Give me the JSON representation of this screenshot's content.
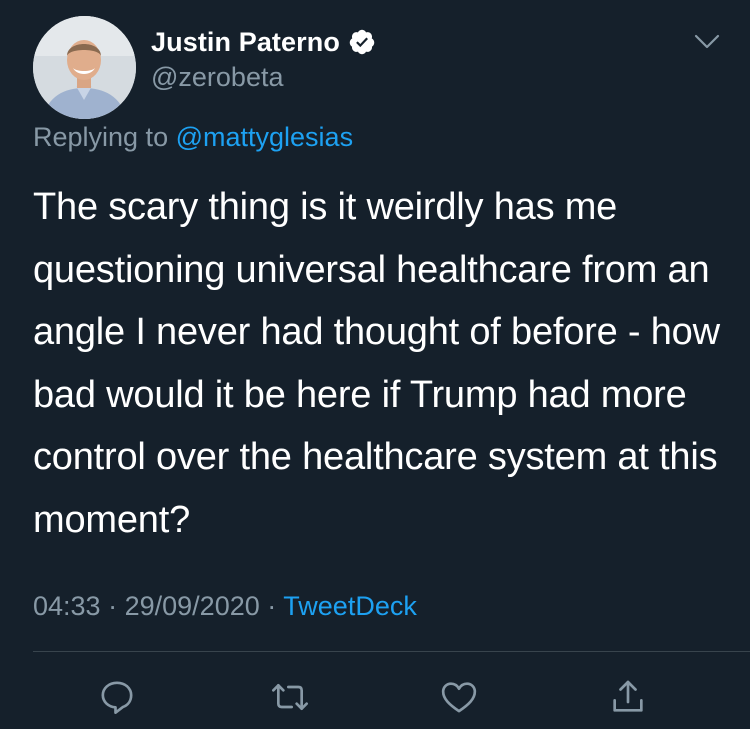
{
  "author": {
    "display_name": "Justin Paterno",
    "handle": "@zerobeta",
    "verified_icon": "verified-badge-icon"
  },
  "reply": {
    "prefix": "Replying to",
    "mention": "@mattyglesias"
  },
  "tweet": {
    "text": "The scary thing is it weirdly has me questioning universal healthcare from an angle I never had thought of before - how bad would it be here if Trump had more control over the healthcare system at this moment?"
  },
  "meta": {
    "time": "04:33",
    "separator": "·",
    "date": "29/09/2020",
    "source": "TweetDeck"
  },
  "actions": [
    "reply-icon",
    "retweet-icon",
    "like-icon",
    "share-icon"
  ],
  "colors": {
    "background": "#15202b",
    "muted": "#8899a6",
    "accent": "#1da1f2",
    "divider": "#38444d"
  }
}
